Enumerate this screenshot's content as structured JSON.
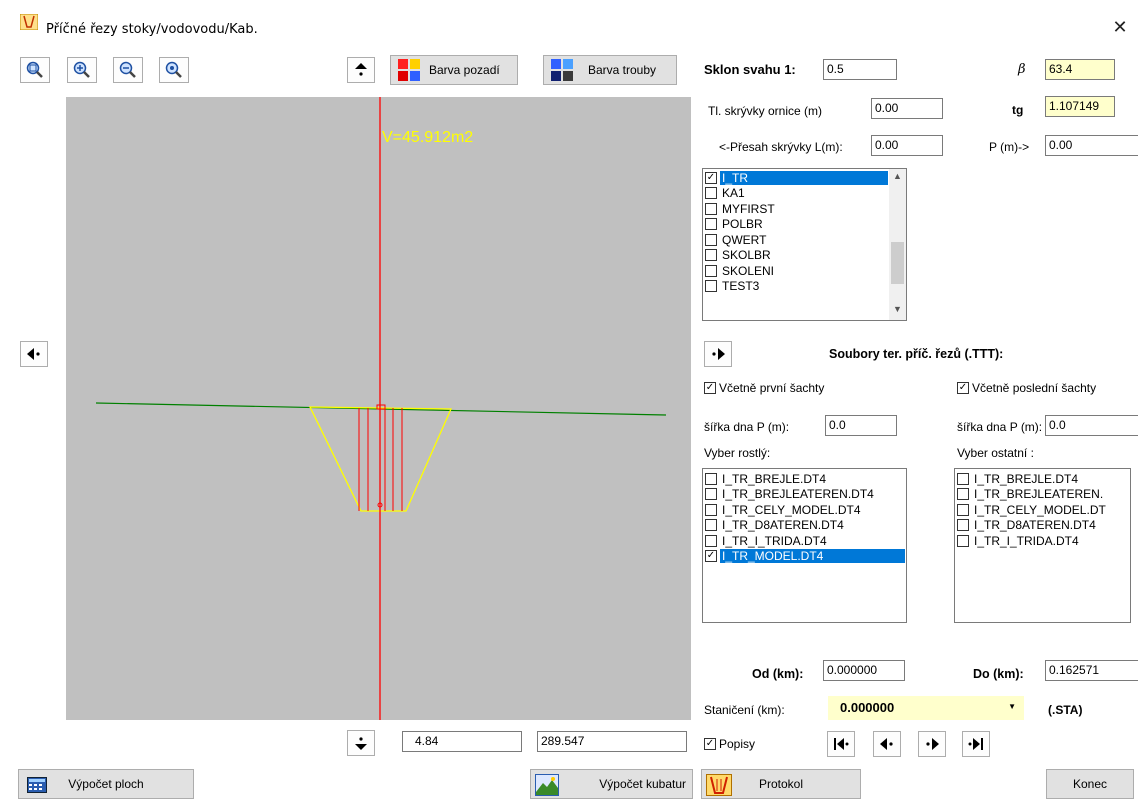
{
  "window": {
    "title": "Příčné řezy stoky/vodovodu/Kab.",
    "close_glyph": "✕"
  },
  "toolbar": {
    "barva_pozadi": "Barva pozadí",
    "barva_trouby": "Barva trouby"
  },
  "canvas": {
    "volume_label": "V=45.912m2",
    "background_color": "#c0c0c0",
    "terrain_color": "#008000",
    "trench_color": "#ffff00",
    "axis_color": "#ff0000"
  },
  "params": {
    "sklon_label": "Sklon svahu 1:",
    "sklon_value": "0.5",
    "beta_label": "β",
    "beta_value": "63.4",
    "skryvka_label": "Tl. skrývky ornice (m)",
    "skryvka_value": "0.00",
    "tg_label": "tg",
    "tg_value": "1.107149",
    "presah_label": "<-Přesah skrývky L(m):",
    "presah_value": "0.00",
    "p_label": "P (m)->",
    "p_value": "0.00"
  },
  "layers": [
    {
      "label": "I_TR",
      "checked": true,
      "selected": true
    },
    {
      "label": "KA1",
      "checked": false,
      "selected": false
    },
    {
      "label": "MYFIRST",
      "checked": false,
      "selected": false
    },
    {
      "label": "POLBR",
      "checked": false,
      "selected": false
    },
    {
      "label": "QWERT",
      "checked": false,
      "selected": false
    },
    {
      "label": "SKOLBR",
      "checked": false,
      "selected": false
    },
    {
      "label": "SKOLENI",
      "checked": false,
      "selected": false
    },
    {
      "label": "TEST3",
      "checked": false,
      "selected": false
    }
  ],
  "files_label": "Soubory ter. příč. řezů (.TTT):",
  "include_first": {
    "label": "Včetně první šachty",
    "checked": true
  },
  "include_last": {
    "label": "Včetně poslední šachty",
    "checked": true
  },
  "width_left": {
    "label": "šířka dna P (m):",
    "value": "0.0"
  },
  "width_right": {
    "label": "šířka dna P (m):",
    "value": "0.0"
  },
  "rostly_label": "Vyber rostlý:",
  "ostatni_label": "Vyber ostatní :",
  "rostly_items": [
    {
      "label": "I_TR_BREJLE.DT4",
      "checked": false,
      "selected": false
    },
    {
      "label": "I_TR_BREJLEATEREN.DT4",
      "checked": false,
      "selected": false
    },
    {
      "label": "I_TR_CELY_MODEL.DT4",
      "checked": false,
      "selected": false
    },
    {
      "label": "I_TR_D8ATEREN.DT4",
      "checked": false,
      "selected": false
    },
    {
      "label": "I_TR_I_TRIDA.DT4",
      "checked": false,
      "selected": false
    },
    {
      "label": "I_TR_MODEL.DT4",
      "checked": true,
      "selected": true
    }
  ],
  "ostatni_items": [
    {
      "label": "I_TR_BREJLE.DT4",
      "checked": false
    },
    {
      "label": "I_TR_BREJLEATEREN.",
      "checked": false
    },
    {
      "label": "I_TR_CELY_MODEL.DT",
      "checked": false
    },
    {
      "label": "I_TR_D8ATEREN.DT4",
      "checked": false
    },
    {
      "label": "I_TR_I_TRIDA.DT4",
      "checked": false
    }
  ],
  "range": {
    "od_label": "Od (km):",
    "od_value": "0.000000",
    "do_label": "Do (km):",
    "do_value": "0.162571"
  },
  "staniceni": {
    "label": "Staničení (km):",
    "value": "0.000000",
    "sta_label": "(.STA)"
  },
  "coords": {
    "x": "4.84",
    "y": "289.547"
  },
  "popisy": {
    "label": "Popisy",
    "checked": true
  },
  "bottom": {
    "vypocet_ploch": "Výpočet ploch",
    "vypocet_kubatur": "Výpočet kubatur",
    "protokol": "Protokol",
    "konec": "Konec"
  }
}
